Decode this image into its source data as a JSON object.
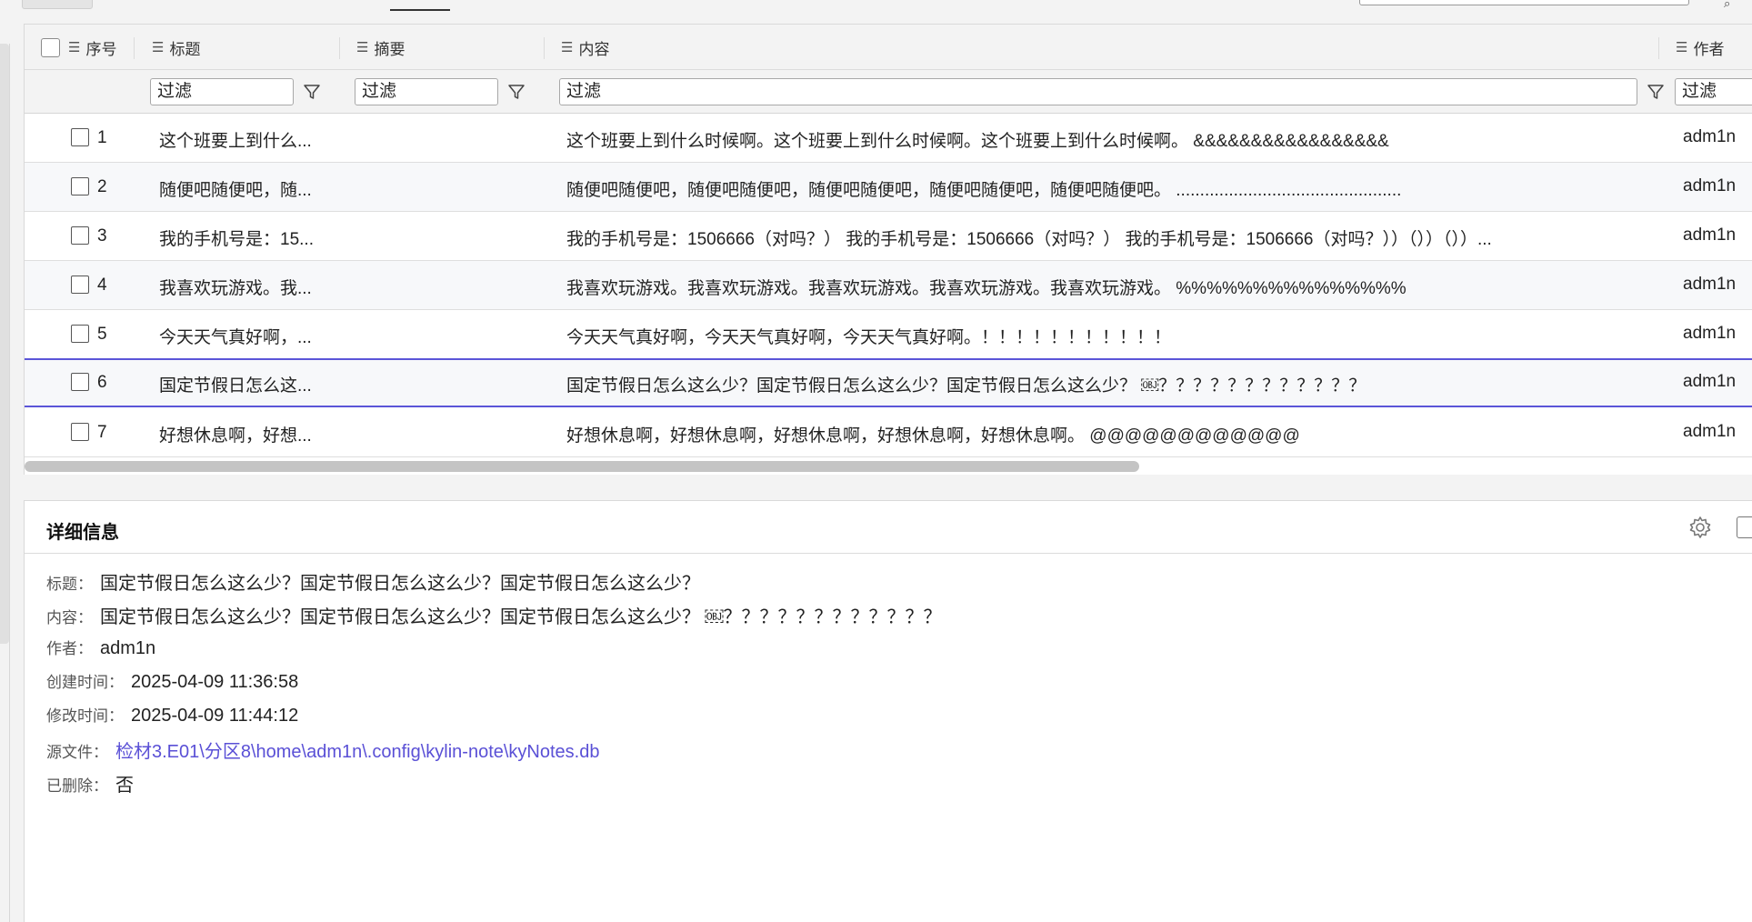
{
  "grid": {
    "columns": {
      "seq": "序号",
      "title": "标题",
      "summary": "摘要",
      "content": "内容",
      "author": "作者"
    },
    "filter_placeholder": "过滤",
    "rows": [
      {
        "num": "1",
        "title": "这个班要上到什么...",
        "content": "这个班要上到什么时候啊。这个班要上到什么时候啊。这个班要上到什么时候啊。 &&&&&&&&&&&&&&&&&",
        "author": "adm1n"
      },
      {
        "num": "2",
        "title": "随便吧随便吧，随...",
        "content": "随便吧随便吧，随便吧随便吧，随便吧随便吧，随便吧随便吧，随便吧随便吧。 ...............................................",
        "author": "adm1n"
      },
      {
        "num": "3",
        "title": "我的手机号是：15...",
        "content": "我的手机号是：1506666（对吗？） 我的手机号是：1506666（对吗？） 我的手机号是：1506666（对吗？））（））（））...",
        "author": "adm1n"
      },
      {
        "num": "4",
        "title": "我喜欢玩游戏。我...",
        "content": "我喜欢玩游戏。我喜欢玩游戏。我喜欢玩游戏。我喜欢玩游戏。我喜欢玩游戏。 %%%%%%%%%%%%%%%",
        "author": "adm1n"
      },
      {
        "num": "5",
        "title": "今天天气真好啊，...",
        "content": "今天天气真好啊，今天天气真好啊，今天天气真好啊。！！！！！！！！！！！",
        "author": "adm1n"
      },
      {
        "num": "6",
        "title": "国定节假日怎么这...",
        "content": "国定节假日怎么这么少？国定节假日怎么这么少？国定节假日怎么这么少？ ￼？？？？？？？？？？？？",
        "author": "adm1n"
      },
      {
        "num": "7",
        "title": "好想休息啊，好想...",
        "content": "好想休息啊，好想休息啊，好想休息啊，好想休息啊，好想休息啊。 @@@@@@@@@@@@",
        "author": "adm1n"
      }
    ],
    "selected_row": "6"
  },
  "detail": {
    "header": "详细信息",
    "fields": [
      {
        "label": "标题：",
        "value": "国定节假日怎么这么少？国定节假日怎么这么少？国定节假日怎么这么少？"
      },
      {
        "label": "内容：",
        "value": "国定节假日怎么这么少？国定节假日怎么这么少？国定节假日怎么这么少？ ￼？？？？？？？？？？？？"
      },
      {
        "label": "作者：",
        "value": "adm1n"
      },
      {
        "label": "创建时间：",
        "value": "2025-04-09 11:36:58"
      },
      {
        "label": "修改时间：",
        "value": "2025-04-09 11:44:12"
      },
      {
        "label": "源文件：",
        "value": "检材3.E01\\分区8\\home\\adm1n\\.config\\kylin-note\\kyNotes.db"
      },
      {
        "label": "已删除：",
        "value": "否"
      }
    ]
  },
  "colors": {
    "accent": "#5b55d8",
    "link": "#5a50d6"
  }
}
